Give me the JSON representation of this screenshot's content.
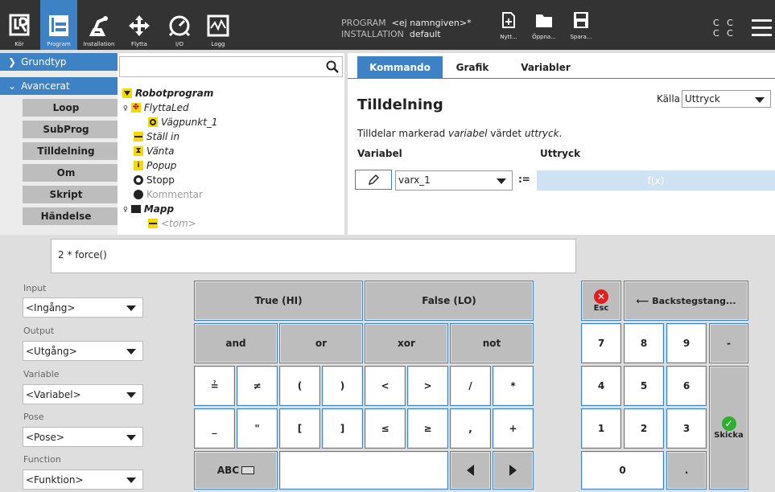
{
  "header": {
    "nav": [
      {
        "label": "Kör",
        "icon": "ur-logo-icon"
      },
      {
        "label": "Program",
        "icon": "program-icon"
      },
      {
        "label": "Installation",
        "icon": "installation-icon"
      },
      {
        "label": "Flytta",
        "icon": "move-icon"
      },
      {
        "label": "I/O",
        "icon": "io-icon"
      },
      {
        "label": "Logg",
        "icon": "log-icon"
      }
    ],
    "program_label": "PROGRAM",
    "program_value": "<ej namngiven>*",
    "installation_label": "INSTALLATION",
    "installation_value": "default",
    "file_buttons": [
      {
        "label": "Nytt...",
        "icon": "new-file-icon"
      },
      {
        "label": "Öppna...",
        "icon": "folder-icon"
      },
      {
        "label": "Spara...",
        "icon": "save-icon"
      }
    ],
    "cc_row1": "C C",
    "cc_row2": "C C"
  },
  "leftnav": {
    "groups": [
      "Grundtyp",
      "Avancerat"
    ],
    "items": [
      "Loop",
      "SubProg",
      "Tilldelning",
      "Om",
      "Skript",
      "Händelse"
    ]
  },
  "tree": {
    "nodes": [
      {
        "label": "Robotprogram"
      },
      {
        "label": "FlyttaLed"
      },
      {
        "label": "Vägpunkt_1"
      },
      {
        "label": "Ställ in"
      },
      {
        "label": "Vänta"
      },
      {
        "label": "Popup"
      },
      {
        "label": "Stopp"
      },
      {
        "label": "Kommentar"
      },
      {
        "label": "Mapp"
      },
      {
        "label": "<tom>"
      }
    ]
  },
  "rpanel": {
    "tabs": [
      "Kommando",
      "Grafik",
      "Variabler"
    ],
    "title": "Tilldelning",
    "source_label": "Källa",
    "source_value": "Uttryck",
    "desc_pre": "Tilldelar markerad ",
    "desc_var": "variabel",
    "desc_mid": " värdet ",
    "desc_expr": "uttryck",
    "desc_end": ".",
    "col_variable": "Variabel",
    "col_expression": "Uttryck",
    "variable_value": "varx_1",
    "assign_op": ":=",
    "fx": "f(x)"
  },
  "expression": "2 * force()",
  "selectors": [
    {
      "label": "Input",
      "value": "<Ingång>"
    },
    {
      "label": "Output",
      "value": "<Utgång>"
    },
    {
      "label": "Variable",
      "value": "<Variabel>"
    },
    {
      "label": "Pose",
      "value": "<Pose>"
    },
    {
      "label": "Function",
      "value": "<Funktion>"
    }
  ],
  "keys": {
    "true": "True (HI)",
    "false": "False (LO)",
    "and": "and",
    "or": "or",
    "xor": "xor",
    "not": "not",
    "r3": [
      "≟",
      "≠",
      "(",
      ")",
      "<",
      ">",
      "/",
      "*"
    ],
    "r4": [
      "_",
      "\"",
      "[",
      "]",
      "≤",
      "≥",
      ",",
      "+"
    ],
    "abc": "ABC",
    "esc": "Esc",
    "backspace": "Backstegstang...",
    "nums": [
      "7",
      "8",
      "9",
      "-",
      "4",
      "5",
      "6",
      "1",
      "2",
      "3",
      "0",
      "."
    ],
    "submit": "Skicka"
  },
  "colors": {
    "accent": "#3d82c4",
    "header": "#333333",
    "warn": "#e02020",
    "ok": "#2fae2f"
  }
}
